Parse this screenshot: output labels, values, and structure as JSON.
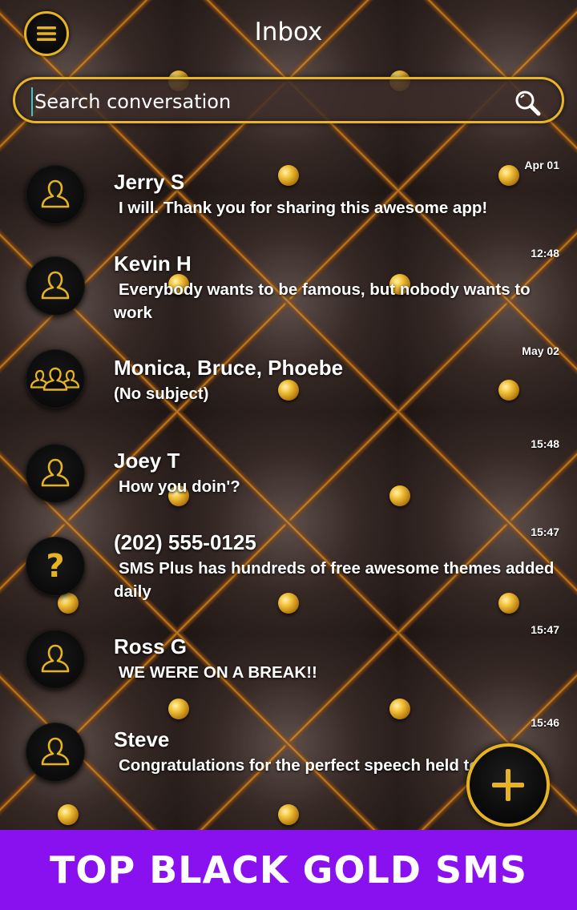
{
  "header": {
    "title": "Inbox"
  },
  "search": {
    "placeholder": "Search conversation"
  },
  "conversations": [
    {
      "name": "Jerry S",
      "snippet": "I will. Thank you for sharing this awesome app!",
      "time": "Apr 01",
      "avatar": "person-icon"
    },
    {
      "name": "Kevin H",
      "snippet": "Everybody wants to be famous, but nobody wants to work",
      "time": "12:48",
      "avatar": "person-icon"
    },
    {
      "name": "Monica, Bruce, Phoebe",
      "snippet": "(No subject)",
      "time": "May 02",
      "avatar": "group-icon"
    },
    {
      "name": "Joey T",
      "snippet": "How you doin'?",
      "time": "15:48",
      "avatar": "person-icon"
    },
    {
      "name": "(202) 555-0125",
      "snippet": "SMS Plus has hundreds of free awesome themes added daily",
      "time": "15:47",
      "avatar": "unknown-contact-icon"
    },
    {
      "name": "Ross G",
      "snippet": "WE WERE ON A BREAK!!",
      "time": "15:47",
      "avatar": "person-icon"
    },
    {
      "name": "Steve",
      "snippet": "Congratulations for the perfect speech held today",
      "time": "15:46",
      "avatar": "person-icon"
    }
  ],
  "banner": {
    "text": "TOP BLACK GOLD SMS"
  },
  "colors": {
    "accent_gold": "#e6b422",
    "banner_purple": "#8a11ef",
    "leather": "#2a1f1c"
  },
  "icons": {
    "menu": "hamburger-menu-icon",
    "search": "search-icon",
    "compose": "plus-icon"
  }
}
